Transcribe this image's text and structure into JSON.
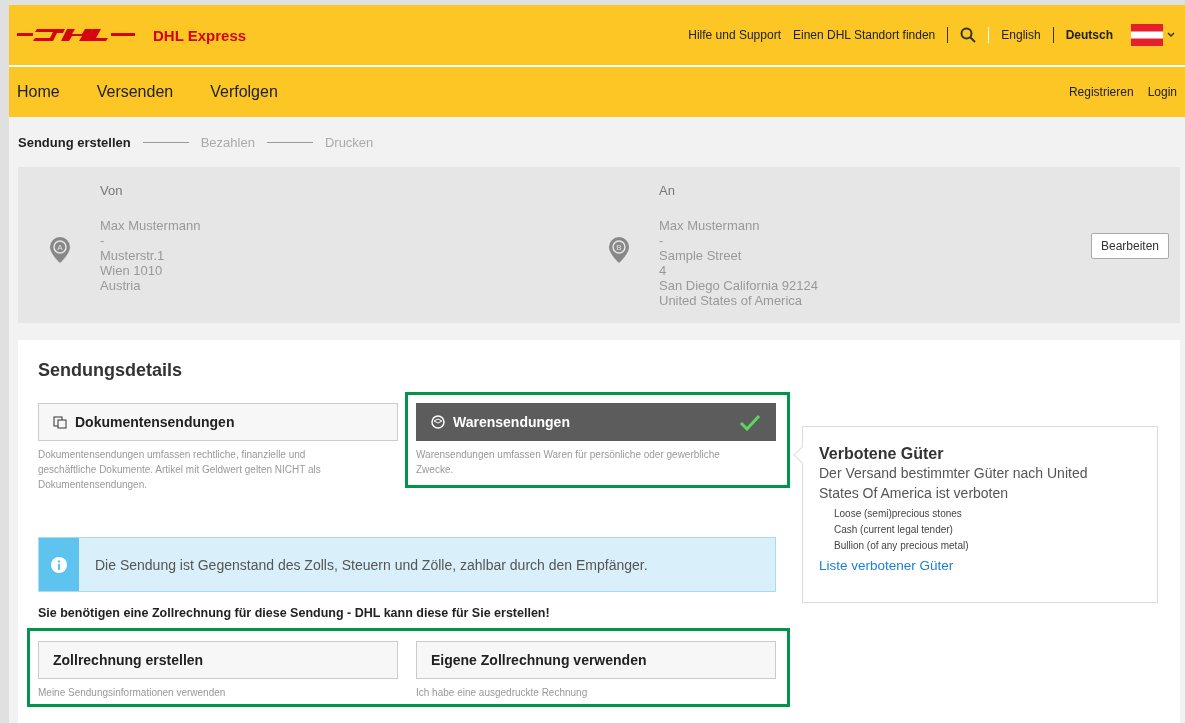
{
  "header": {
    "brand": "DHL Express",
    "links": [
      {
        "label": "Hilfe und Support"
      },
      {
        "label": "Einen DHL Standort finden"
      }
    ],
    "languages": [
      {
        "label": "English",
        "selected": false
      },
      {
        "label": "Deutsch",
        "selected": true
      }
    ]
  },
  "nav": {
    "items": [
      {
        "label": "Home"
      },
      {
        "label": "Versenden"
      },
      {
        "label": "Verfolgen"
      }
    ],
    "account": [
      {
        "label": "Registrieren"
      },
      {
        "label": "Login"
      }
    ]
  },
  "steps": [
    {
      "label": "Sendung erstellen",
      "selected": true
    },
    {
      "label": "Bezahlen",
      "selected": false
    },
    {
      "label": "Drucken",
      "selected": false
    }
  ],
  "addresses": [
    {
      "heading": "Von",
      "marker": "A",
      "lines": [
        "Max Mustermann",
        "-",
        "Musterstr.1",
        "Wien 1010",
        "Austria"
      ]
    },
    {
      "heading": "An",
      "marker": "B",
      "lines": [
        "Max Mustermann",
        "-",
        "Sample Street",
        "4",
        "San Diego California 92124",
        "United States of America"
      ]
    }
  ],
  "edit_button": "Bearbeiten",
  "details": {
    "title": "Sendungsdetails",
    "shipment_types": [
      {
        "kind": "documents",
        "label": "Dokumentensendungen",
        "description": "Dokumentensendungen umfassen rechtliche, finanzielle und geschäftliche Dokumente. Artikel mit Geldwert gelten NICHT als Dokumentensendungen.",
        "selected": false,
        "highlighted": false
      },
      {
        "kind": "goods",
        "label": "Warensendungen",
        "description": "Warensendungen umfassen Waren für persönliche oder gewerbliche Zwecke.",
        "selected": true,
        "highlighted": true
      }
    ],
    "info": "Die Sendung ist Gegenstand des Zolls, Steuern und Zölle, zahlbar durch den Empfänger.",
    "invoice_prompt": "Sie benötigen eine Zollrechnung für diese Sendung - DHL kann diese für Sie erstellen!",
    "invoice_options": {
      "highlighted": true,
      "items": [
        {
          "label": "Zollrechnung erstellen",
          "description": "Meine Sendungsinformationen verwenden"
        },
        {
          "label": "Eigene Zollrechnung verwenden",
          "description": "Ich habe eine ausgedruckte Rechnung"
        }
      ]
    },
    "prohibited": {
      "title": "Verbotene Güter",
      "text": "Der Versand bestimmter Güter nach United States Of America ist verboten",
      "items": [
        "Loose (semi)precious stones",
        "Cash (current legal tender)",
        "Bullion (of any precious metal)"
      ],
      "link": "Liste verbotener Güter"
    }
  }
}
